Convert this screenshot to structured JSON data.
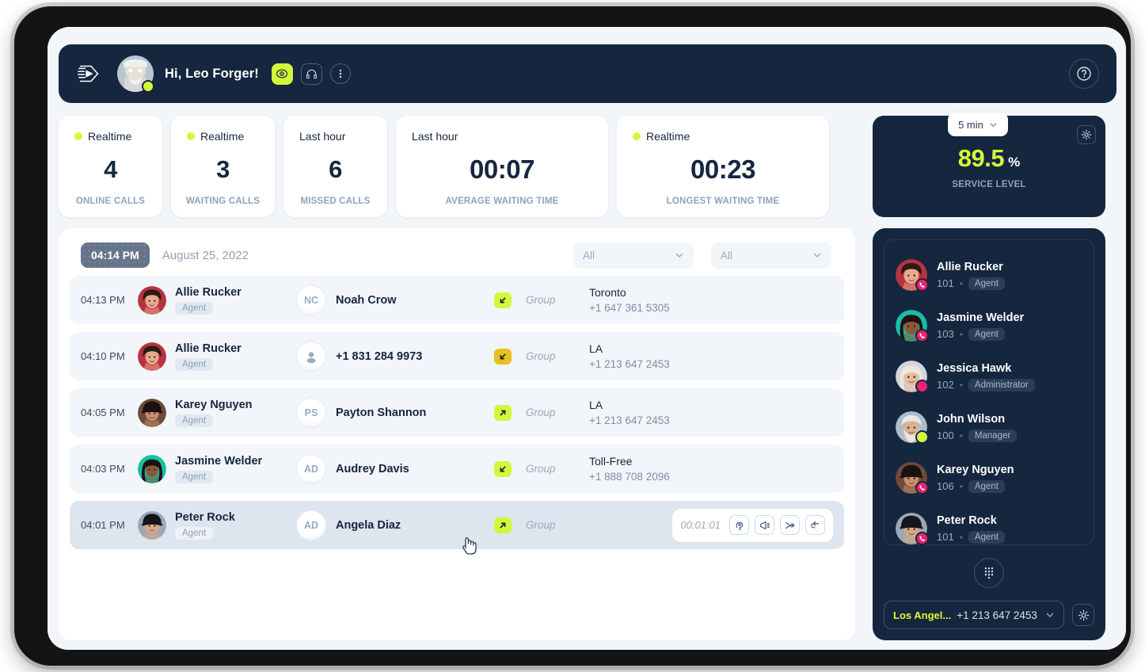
{
  "topbar": {
    "logo_icon": "wing-logo-icon",
    "greeting": "Hi, Leo Forger!",
    "status": "online",
    "actions": [
      {
        "icon": "eye-icon",
        "style": "filled"
      },
      {
        "icon": "headset-icon",
        "style": "outline"
      },
      {
        "icon": "more-vertical-icon",
        "style": "circle"
      }
    ],
    "help_icon": "question-circle-icon"
  },
  "kpis": [
    {
      "period": "Realtime",
      "live": true,
      "value": "4",
      "label": "ONLINE CALLS"
    },
    {
      "period": "Realtime",
      "live": true,
      "value": "3",
      "label": "WAITING CALLS"
    },
    {
      "period": "Last hour",
      "live": false,
      "value": "6",
      "label": "MISSED CALLS"
    },
    {
      "period": "Last hour",
      "live": false,
      "value": "00:07",
      "label": "AVERAGE WAITING TIME"
    },
    {
      "period": "Realtime",
      "live": true,
      "value": "00:23",
      "label": "LONGEST WAITING TIME"
    }
  ],
  "service_level": {
    "period_option": "5 min",
    "value": "89.5",
    "unit": "%",
    "label": "SERVICE LEVEL",
    "accent_color": "#d3f83a",
    "gear_icon": "gear-icon"
  },
  "calls": {
    "clock": "04:14 PM",
    "date": "August 25, 2022",
    "filters": [
      {
        "value": "All",
        "placeholder": "All"
      },
      {
        "value": "All",
        "placeholder": "All"
      }
    ],
    "rows": [
      {
        "time": "04:13 PM",
        "agent": "Allie Rucker",
        "role": "Agent",
        "contact": "Noah Crow",
        "initials": "NC",
        "contact_is_number": false,
        "direction": "inbound",
        "dir_color": "#d3f83a",
        "group": "Group",
        "location": "Toronto",
        "number": "+1 647 361 5305",
        "active": false
      },
      {
        "time": "04:10 PM",
        "agent": "Allie Rucker",
        "role": "Agent",
        "contact": "+1 831 284 9973",
        "initials": "",
        "contact_is_number": true,
        "direction": "inbound",
        "dir_color": "#e8c020",
        "group": "Group",
        "location": "LA",
        "number": "+1 213 647 2453",
        "active": false
      },
      {
        "time": "04:05 PM",
        "agent": "Karey Nguyen",
        "role": "Agent",
        "contact": "Payton Shannon",
        "initials": "PS",
        "contact_is_number": false,
        "direction": "outbound",
        "dir_color": "#d3f83a",
        "group": "Group",
        "location": "LA",
        "number": "+1 213 647 2453",
        "active": false
      },
      {
        "time": "04:03 PM",
        "agent": "Jasmine Welder",
        "role": "Agent",
        "contact": "Audrey Davis",
        "initials": "AD",
        "contact_is_number": false,
        "direction": "inbound",
        "dir_color": "#d3f83a",
        "group": "Group",
        "location": "Toll-Free",
        "number": "+1 888 708 2096",
        "active": false
      },
      {
        "time": "04:01 PM",
        "agent": "Peter Rock",
        "role": "Agent",
        "contact": "Angela Diaz",
        "initials": "AD",
        "contact_is_number": false,
        "direction": "outbound",
        "dir_color": "#d3f83a",
        "group": "Group",
        "location": "",
        "number": "",
        "active": true,
        "duration": "00:01:01",
        "actions": [
          "listen-icon",
          "whisper-icon",
          "transfer-icon",
          "barge-icon"
        ]
      }
    ]
  },
  "sidebar": {
    "agents": [
      {
        "name": "Allie Rucker",
        "ext": "101",
        "role": "Agent",
        "status": "oncall"
      },
      {
        "name": "Jasmine Welder",
        "ext": "103",
        "role": "Agent",
        "status": "oncall"
      },
      {
        "name": "Jessica Hawk",
        "ext": "102",
        "role": "Administrator",
        "status": "busy"
      },
      {
        "name": "John Wilson",
        "ext": "100",
        "role": "Manager",
        "status": "online"
      },
      {
        "name": "Karey Nguyen",
        "ext": "106",
        "role": "Agent",
        "status": "oncall"
      },
      {
        "name": "Peter Rock",
        "ext": "101",
        "role": "Agent",
        "status": "oncall"
      }
    ],
    "dialpad_icon": "dialpad-icon",
    "phone": {
      "label": "Los Angel...",
      "number": "+1 213 647 2453",
      "gear_icon": "gear-icon"
    }
  }
}
